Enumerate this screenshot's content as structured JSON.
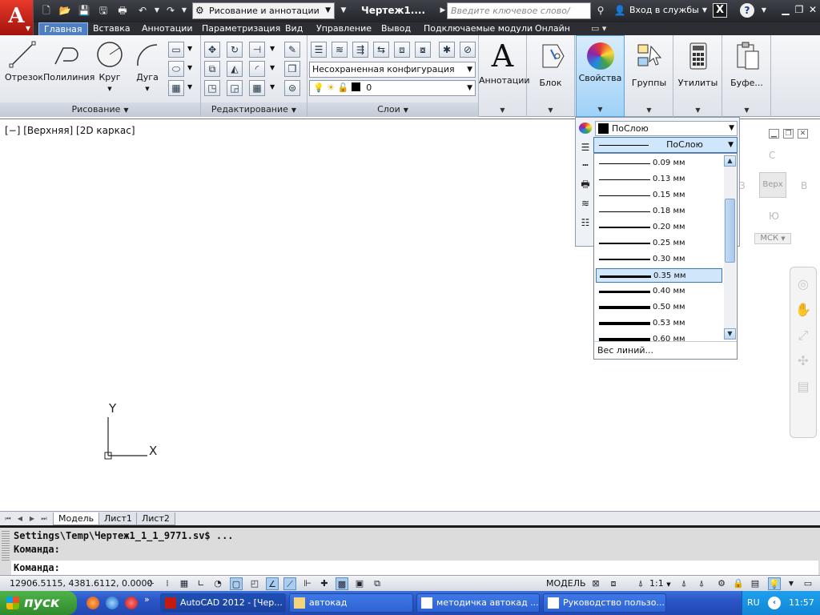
{
  "titlebar": {
    "app_letter": "A",
    "workspace": "Рисование и аннотации",
    "doc_title": "Чертеж1....",
    "search_placeholder": "Введите ключевое слово/фразу",
    "signin": "Вход в службы",
    "help": "?"
  },
  "tabs": [
    "Главная",
    "Вставка",
    "Аннотации",
    "Параметризация",
    "Вид",
    "Управление",
    "Вывод",
    "Подключаемые модули",
    "Онлайн"
  ],
  "ribbon": {
    "draw": {
      "title": "Рисование",
      "tools": [
        "Отрезок",
        "Полилиния",
        "Круг",
        "Дуга"
      ]
    },
    "modify": {
      "title": "Редактирование"
    },
    "layers": {
      "title": "Слои",
      "state_combo": "Несохраненная конфигурация слоев",
      "layer_combo": "0"
    },
    "big_buttons": [
      "Аннотации",
      "Блок",
      "Свойства",
      "Группы",
      "Утилиты",
      "Буфе..."
    ]
  },
  "viewport": {
    "label": "[−] [Верхняя] [2D каркас]",
    "ucs_y": "Y",
    "ucs_x": "X"
  },
  "viewcube": {
    "north": "С",
    "south": "Ю",
    "west": "З",
    "east": "В",
    "face": "Верх",
    "ucs": "МСК"
  },
  "properties": {
    "color": "ПоСлою",
    "lineweight": "ПоСлою",
    "lineweight_list": [
      {
        "label": "0.09 мм",
        "mm": 0.09
      },
      {
        "label": "0.13 мм",
        "mm": 0.13
      },
      {
        "label": "0.15 мм",
        "mm": 0.15
      },
      {
        "label": "0.18 мм",
        "mm": 0.18
      },
      {
        "label": "0.20 мм",
        "mm": 0.2
      },
      {
        "label": "0.25 мм",
        "mm": 0.25
      },
      {
        "label": "0.30 мм",
        "mm": 0.3
      },
      {
        "label": "0.35 мм",
        "mm": 0.35
      },
      {
        "label": "0.40 мм",
        "mm": 0.4
      },
      {
        "label": "0.50 мм",
        "mm": 0.5
      },
      {
        "label": "0.53 мм",
        "mm": 0.53
      },
      {
        "label": "0.60 мм",
        "mm": 0.6
      }
    ],
    "selected": "0.35 мм",
    "more": "Вес линий..."
  },
  "layout_tabs": [
    "Модель",
    "Лист1",
    "Лист2"
  ],
  "cmdline": {
    "history1": "Settings\\Temp\\Чертеж1_1_1_9771.sv$ ...",
    "history2": "Команда:",
    "prompt": "Команда:"
  },
  "statusbar": {
    "coords": "12906.5115, 4381.6112, 0.0000",
    "model": "МОДЕЛЬ",
    "scale": "1:1"
  },
  "taskbar": {
    "start": "пуск",
    "tasks": [
      "AutoCAD 2012 - [Чер...",
      "автокад",
      "методичка автокад ...",
      "Руководство пользо..."
    ],
    "lang": "RU",
    "clock": "11:57"
  }
}
